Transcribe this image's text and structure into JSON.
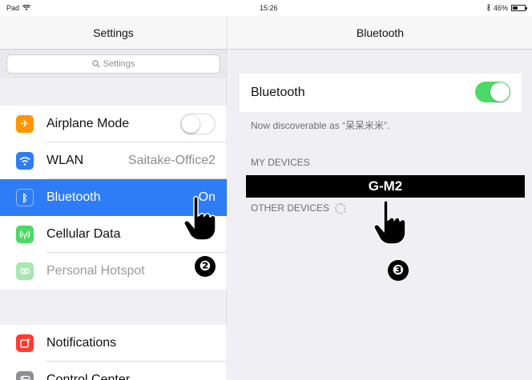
{
  "status_bar": {
    "device": "Pad",
    "time": "15:26",
    "battery": "46%",
    "battery_level": 0.46
  },
  "left_pane": {
    "title": "Settings",
    "search_placeholder": "Settings",
    "group1": [
      {
        "label": "Airplane Mode",
        "icon": "airplane-icon",
        "color": "#ff9500",
        "toggle": "off"
      },
      {
        "label": "WLAN",
        "icon": "wifi-icon",
        "color": "#2f7df6",
        "detail": "Saitake-Office2"
      },
      {
        "label": "Bluetooth",
        "icon": "bluetooth-icon",
        "color": "#2f7df6",
        "detail": "On",
        "selected": true
      },
      {
        "label": "Cellular Data",
        "icon": "cellular-icon",
        "color": "#4cd964"
      },
      {
        "label": "Personal Hotspot",
        "icon": "hotspot-icon",
        "color": "#4cd964",
        "dimmed": true
      }
    ],
    "group2": [
      {
        "label": "Notifications",
        "icon": "notifications-icon",
        "color": "#ff3b30"
      },
      {
        "label": "Control Center",
        "icon": "control-center-icon",
        "color": "#8e8e93"
      }
    ]
  },
  "right_pane": {
    "title": "Bluetooth",
    "bluetooth_label": "Bluetooth",
    "bluetooth_toggle": "on",
    "discoverable_text": "Now discoverable as “呆呆米米”.",
    "my_devices_label": "MY DEVICES",
    "device_name": "G-M2",
    "other_devices_label": "OTHER DEVICES"
  },
  "annotations": {
    "step2": "❷",
    "step3": "❸"
  }
}
